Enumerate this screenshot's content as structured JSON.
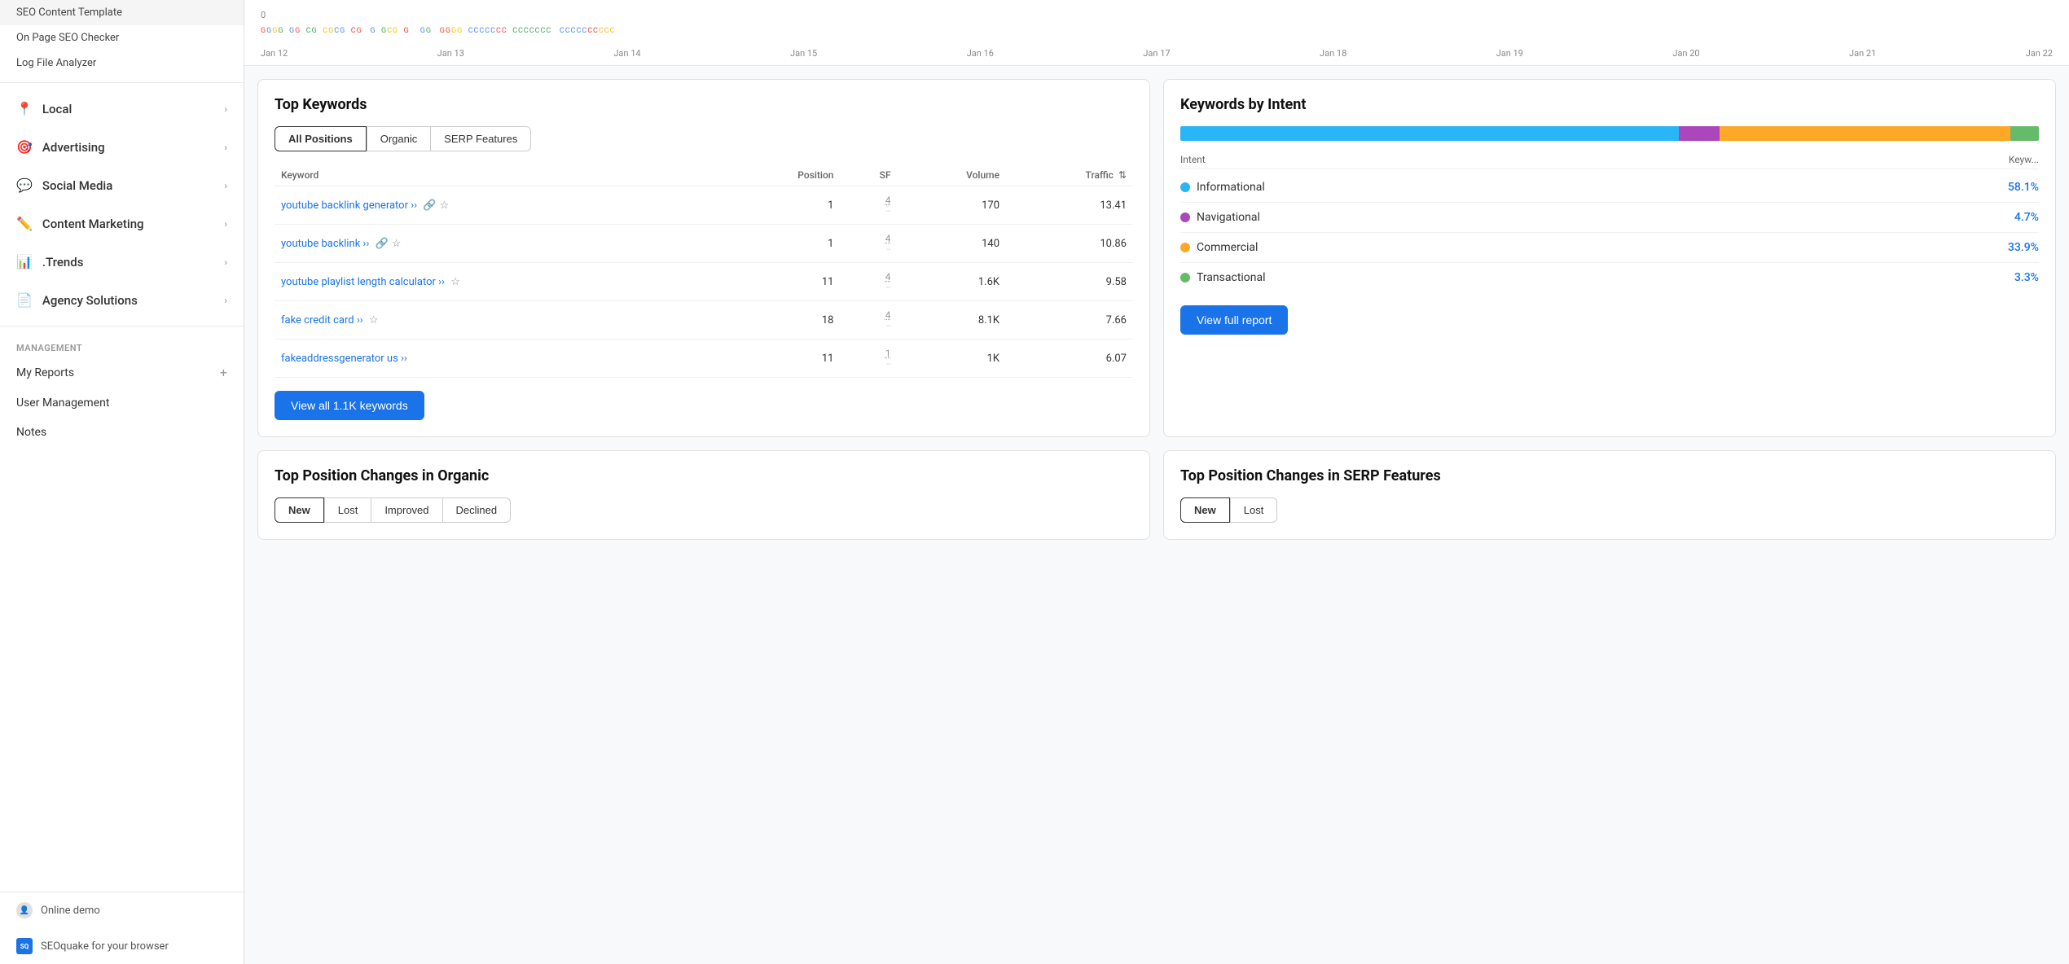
{
  "sidebar": {
    "nav_items": [
      {
        "id": "local",
        "label": "Local",
        "icon": "📍",
        "has_chevron": true
      },
      {
        "id": "advertising",
        "label": "Advertising",
        "icon": "🎯",
        "has_chevron": true
      },
      {
        "id": "social-media",
        "label": "Social Media",
        "icon": "💬",
        "has_chevron": true
      },
      {
        "id": "content-marketing",
        "label": "Content Marketing",
        "icon": "✏️",
        "has_chevron": true
      },
      {
        "id": "trends",
        "label": ".Trends",
        "icon": "📊",
        "has_chevron": true
      },
      {
        "id": "agency-solutions",
        "label": "Agency Solutions",
        "icon": "📄",
        "has_chevron": true
      }
    ],
    "plain_items": [
      {
        "id": "seo-content-template",
        "label": "SEO Content Template"
      },
      {
        "id": "on-page-seo-checker",
        "label": "On Page SEO Checker"
      },
      {
        "id": "log-file-analyzer",
        "label": "Log File Analyzer"
      }
    ],
    "management_section_title": "MANAGEMENT",
    "management_items": [
      {
        "id": "my-reports",
        "label": "My Reports",
        "has_plus": true
      },
      {
        "id": "user-management",
        "label": "User Management",
        "has_plus": false
      },
      {
        "id": "notes",
        "label": "Notes",
        "has_plus": false
      }
    ],
    "bottom_items": [
      {
        "id": "online-demo",
        "label": "Online demo",
        "icon": "👤"
      },
      {
        "id": "seoquake",
        "label": "SEOquake for your browser",
        "icon": "SQ"
      }
    ]
  },
  "chart": {
    "zero_label": "0",
    "dates": [
      "Jan 12",
      "Jan 13",
      "Jan 14",
      "Jan 15",
      "Jan 16",
      "Jan 17",
      "Jan 18",
      "Jan 19",
      "Jan 20",
      "Jan 21",
      "Jan 22"
    ]
  },
  "top_keywords": {
    "title": "Top Keywords",
    "tabs": [
      {
        "id": "all-positions",
        "label": "All Positions",
        "active": true
      },
      {
        "id": "organic",
        "label": "Organic",
        "active": false
      },
      {
        "id": "serp-features",
        "label": "SERP Features",
        "active": false
      }
    ],
    "columns": {
      "keyword": "Keyword",
      "position": "Position",
      "sf": "SF",
      "volume": "Volume",
      "traffic": "Traffic"
    },
    "rows": [
      {
        "keyword": "youtube backlink generator",
        "position": "1",
        "has_link_icon": true,
        "has_star": true,
        "star_filled": false,
        "sf": "4",
        "volume": "170",
        "traffic": "13.41"
      },
      {
        "keyword": "youtube backlink",
        "position": "1",
        "has_link_icon": true,
        "has_star": true,
        "star_filled": false,
        "sf": "4",
        "volume": "140",
        "traffic": "10.86"
      },
      {
        "keyword": "youtube playlist length calculator",
        "position": "11",
        "has_link_icon": false,
        "has_star": true,
        "star_filled": false,
        "sf": "4",
        "volume": "1.6K",
        "traffic": "9.58"
      },
      {
        "keyword": "fake credit card",
        "position": "18",
        "has_link_icon": false,
        "has_star": true,
        "star_filled": false,
        "sf": "4",
        "volume": "8.1K",
        "traffic": "7.66"
      },
      {
        "keyword": "fakeaddressgenerator us",
        "position": "11",
        "has_link_icon": false,
        "has_star": false,
        "star_filled": false,
        "sf": "1",
        "volume": "1K",
        "traffic": "6.07"
      }
    ],
    "view_all_btn": "View all 1.1K keywords"
  },
  "keywords_by_intent": {
    "title": "Keywords by Intent",
    "bar_segments": [
      {
        "id": "informational",
        "color": "#29b6f6",
        "pct": 58.1
      },
      {
        "id": "navigational",
        "color": "#ab47bc",
        "pct": 4.7
      },
      {
        "id": "commercial",
        "color": "#ffa726",
        "pct": 33.9
      },
      {
        "id": "transactional",
        "color": "#66bb6a",
        "pct": 3.3
      }
    ],
    "col_headers": {
      "intent": "Intent",
      "keywords": "Keyw..."
    },
    "intent_rows": [
      {
        "id": "informational",
        "label": "Informational",
        "color": "#29b6f6",
        "pct": "58.1%"
      },
      {
        "id": "navigational",
        "label": "Navigational",
        "color": "#ab47bc",
        "pct": "4.7%"
      },
      {
        "id": "commercial",
        "label": "Commercial",
        "color": "#ffa726",
        "pct": "33.9%"
      },
      {
        "id": "transactional",
        "label": "Transactional",
        "color": "#66bb6a",
        "pct": "3.3%"
      }
    ],
    "view_full_btn": "View full report"
  },
  "top_position_organic": {
    "title": "Top Position Changes in Organic",
    "tabs": [
      {
        "id": "new",
        "label": "New",
        "active": true
      },
      {
        "id": "lost",
        "label": "Lost",
        "active": false
      },
      {
        "id": "improved",
        "label": "Improved",
        "active": false
      },
      {
        "id": "declined",
        "label": "Declined",
        "active": false
      }
    ]
  },
  "top_position_serp": {
    "title": "Top Position Changes in SERP Features",
    "tabs": [
      {
        "id": "new",
        "label": "New",
        "active": true
      },
      {
        "id": "lost",
        "label": "Lost",
        "active": false
      }
    ]
  }
}
